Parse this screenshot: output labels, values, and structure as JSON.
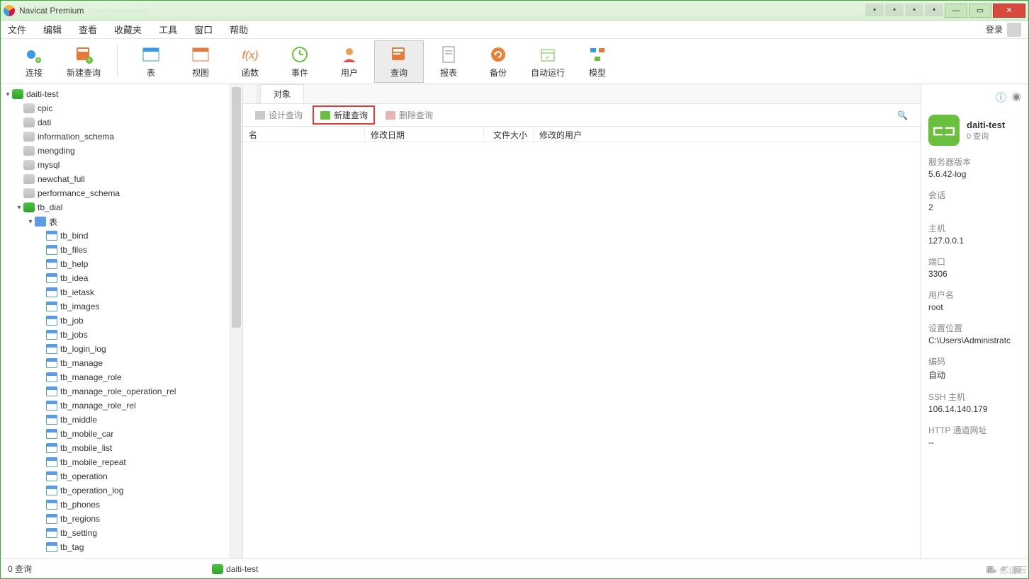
{
  "titlebar": {
    "app_name": "Navicat Premium"
  },
  "menubar": {
    "items": [
      "文件",
      "编辑",
      "查看",
      "收藏夹",
      "工具",
      "窗口",
      "帮助"
    ],
    "login": "登录"
  },
  "toolbar": {
    "items": [
      {
        "label": "连接",
        "icon": "plug"
      },
      {
        "label": "新建查询",
        "icon": "new-query"
      },
      {
        "label": "表",
        "icon": "table",
        "sep_before": true
      },
      {
        "label": "视图",
        "icon": "view"
      },
      {
        "label": "函数",
        "icon": "fx"
      },
      {
        "label": "事件",
        "icon": "clock"
      },
      {
        "label": "用户",
        "icon": "user"
      },
      {
        "label": "查询",
        "icon": "query",
        "active": true
      },
      {
        "label": "报表",
        "icon": "report"
      },
      {
        "label": "备份",
        "icon": "backup"
      },
      {
        "label": "自动运行",
        "icon": "auto"
      },
      {
        "label": "模型",
        "icon": "model"
      }
    ]
  },
  "tree": {
    "root": "daiti-test",
    "databases": [
      "cpic",
      "dati",
      "information_schema",
      "mengding",
      "mysql",
      "newchat_full",
      "performance_schema"
    ],
    "open_db": "tb_dial",
    "tables_node": "表",
    "tables": [
      "tb_bind",
      "tb_files",
      "tb_help",
      "tb_idea",
      "tb_ietask",
      "tb_images",
      "tb_job",
      "tb_jobs",
      "tb_login_log",
      "tb_manage",
      "tb_manage_role",
      "tb_manage_role_operation_rel",
      "tb_manage_role_rel",
      "tb_middle",
      "tb_mobile_car",
      "tb_mobile_list",
      "tb_mobile_repeat",
      "tb_operation",
      "tb_operation_log",
      "tb_phones",
      "tb_regions",
      "tb_setting",
      "tb_tag"
    ]
  },
  "tabs": {
    "objects": "对象"
  },
  "subtoolbar": {
    "design": "设计查询",
    "new_query": "新建查询",
    "delete": "删除查询"
  },
  "list_header": {
    "name": "名",
    "modified": "修改日期",
    "size": "文件大小",
    "user": "修改的用户"
  },
  "right_panel": {
    "conn_name": "daiti-test",
    "conn_sub": "0 查询",
    "kv": [
      {
        "k": "服务器版本",
        "v": "5.6.42-log"
      },
      {
        "k": "会话",
        "v": "2"
      },
      {
        "k": "主机",
        "v": "127.0.0.1"
      },
      {
        "k": "端口",
        "v": "3306"
      },
      {
        "k": "用户名",
        "v": "root"
      },
      {
        "k": "设置位置",
        "v": "C:\\Users\\Administratc"
      },
      {
        "k": "编码",
        "v": "自动"
      },
      {
        "k": "SSH 主机",
        "v": "106.14.140.179"
      },
      {
        "k": "HTTP 通道网址",
        "v": "--"
      }
    ]
  },
  "statusbar": {
    "left": "0 查询",
    "conn": "daiti-test"
  },
  "watermark": "亿速云"
}
